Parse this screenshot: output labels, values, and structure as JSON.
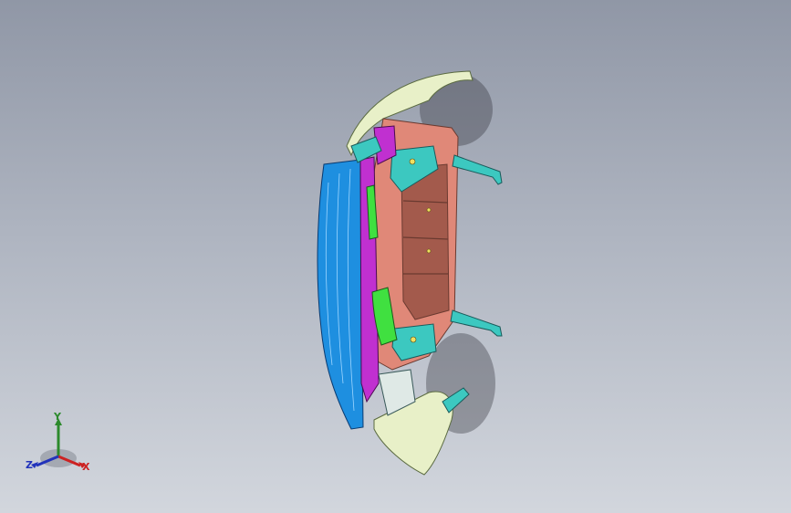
{
  "triad": {
    "x_label": "X",
    "y_label": "Y",
    "z_label": "Z"
  },
  "colors": {
    "background_top": "#9097a6",
    "background_bottom": "#d2d6dd",
    "blue_panel": "#1e8fe0",
    "salmon_frame": "#e08878",
    "cream_shell": "#e8f0c8",
    "teal_parts": "#3cc8c0",
    "magenta_parts": "#c030d0",
    "green_parts": "#40e040",
    "axis_x": "#cc2222",
    "axis_y": "#2c8a2c",
    "axis_z": "#2233bb"
  }
}
